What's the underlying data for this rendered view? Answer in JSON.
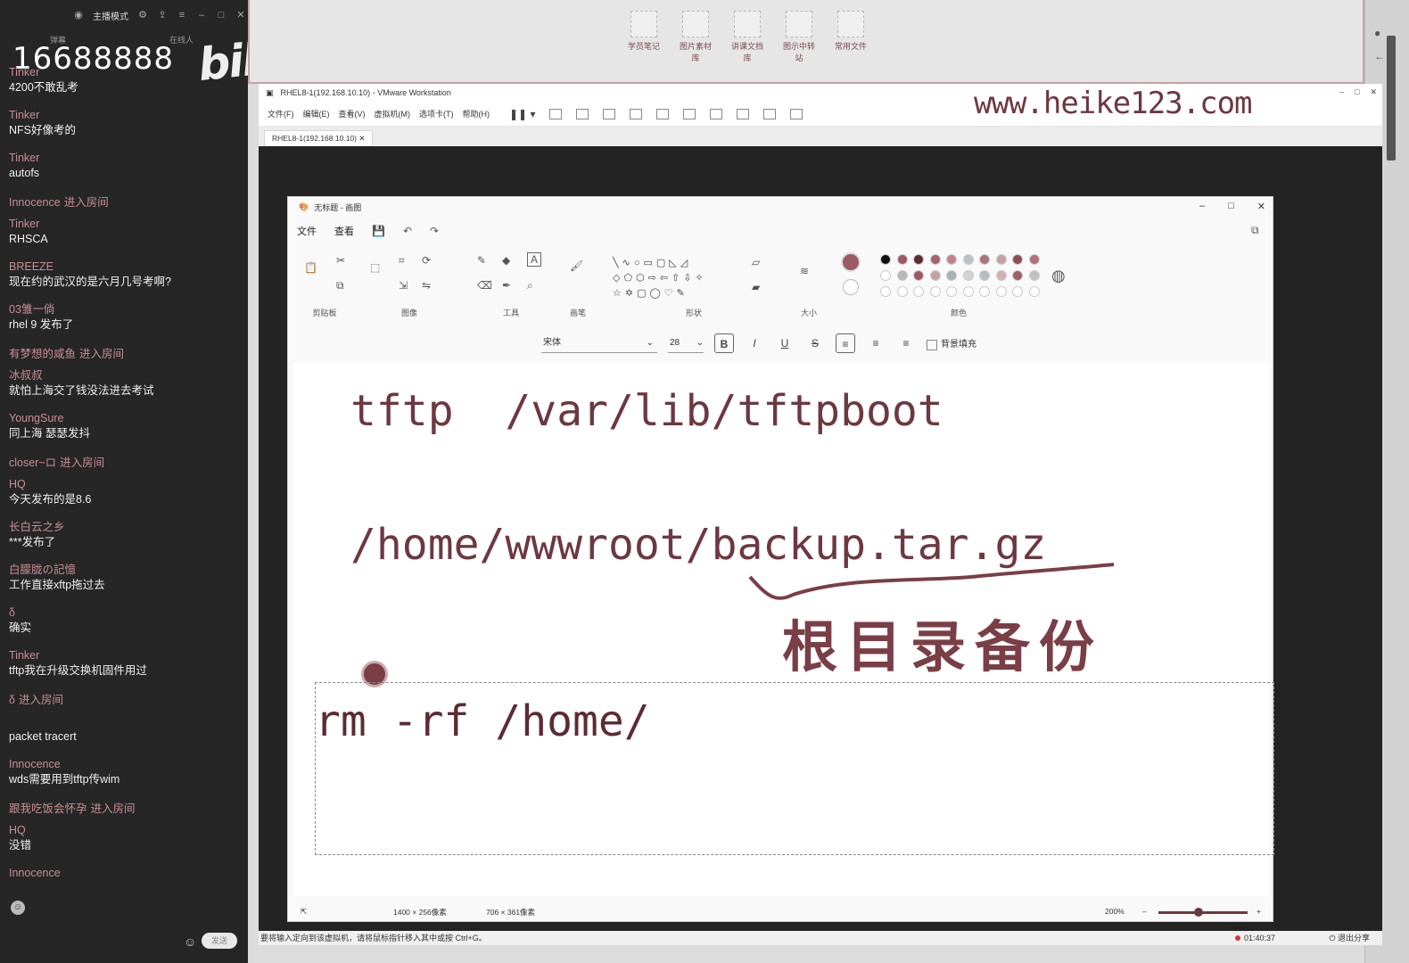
{
  "chat": {
    "topbar": {
      "mode": "主播模式"
    },
    "subtabs": {
      "left": "弹幕",
      "right": "在线人"
    },
    "watermark_number": "16688888",
    "watermark_logo": "bilibili",
    "messages": [
      {
        "user": "Tinker",
        "text": "4200不敢乱考",
        "kind": "msg"
      },
      {
        "user": "Tinker",
        "text": "NFS好像考的",
        "kind": "msg"
      },
      {
        "user": "Tinker",
        "text": "autofs",
        "kind": "msg"
      },
      {
        "user": "Innocence",
        "text": "进入房间",
        "kind": "enter"
      },
      {
        "user": "Tinker",
        "text": "RHSCA",
        "kind": "msg"
      },
      {
        "user": "BREEZE",
        "text": "现在约的武汉的是六月几号考啊?",
        "kind": "msg"
      },
      {
        "user": "03雏一倘",
        "text": "rhel 9 发布了",
        "kind": "msg"
      },
      {
        "user": "有梦想的咸鱼",
        "text": "进入房间",
        "kind": "enter"
      },
      {
        "user": "冰叔叔",
        "text": "就怕上海交了钱没法进去考试",
        "kind": "msg"
      },
      {
        "user": "YoungSure",
        "text": "同上海  瑟瑟发抖",
        "kind": "msg"
      },
      {
        "user": "closer~ロ",
        "text": "进入房间",
        "kind": "enter"
      },
      {
        "user": "HQ",
        "text": "今天发布的是8.6",
        "kind": "msg"
      },
      {
        "user": "长白云之乡",
        "text": "***发布了",
        "kind": "msg"
      },
      {
        "user": "白朦胧の記憶",
        "text": "工作直接xftp拖过去",
        "kind": "msg"
      },
      {
        "user": "δ",
        "text": "确实",
        "kind": "msg"
      },
      {
        "user": "Tinker",
        "text": "tftp我在升级交换机固件用过",
        "kind": "msg"
      },
      {
        "user": "δ",
        "text": "进入房间",
        "kind": "enter"
      },
      {
        "user": "",
        "text": "packet tracert",
        "kind": "msg"
      },
      {
        "user": "Innocence",
        "text": "wds需要用到tftp传wim",
        "kind": "msg"
      },
      {
        "user": "跟我吃饭会怀孕",
        "text": "进入房间",
        "kind": "enter"
      },
      {
        "user": "HQ",
        "text": "没错",
        "kind": "msg"
      },
      {
        "user": "Innocence",
        "text": "",
        "kind": "msg"
      }
    ],
    "send_label": "发送"
  },
  "desktop_icons": [
    "学员笔记",
    "图片素材库",
    "讲课文档库",
    "图示中转站",
    "常用文件"
  ],
  "vmware": {
    "title": "RHEL8-1(192.168.10.10) - VMware Workstation",
    "menu": [
      "文件(F)",
      "编辑(E)",
      "查看(V)",
      "虚拟机(M)",
      "选项卡(T)",
      "帮助(H)"
    ],
    "tab": "RHEL8-1(192.168.10.10)",
    "watermark_url": "www.heike123.com",
    "status_text": "要将输入定向到该虚拟机，请将鼠标指针移入其中或按 Ctrl+G。",
    "timer": "01:40:37",
    "end_share": "退出分享"
  },
  "paint": {
    "title": "无标题 - 画图",
    "menu": [
      "文件",
      "查看"
    ],
    "groups": [
      "剪贴板",
      "图像",
      "工具",
      "画笔",
      "形状",
      "大小",
      "颜色"
    ],
    "font": "宋体",
    "font_size": "28",
    "bg_fill": "背景填充",
    "lines": [
      "tftp  /var/lib/tftpboot",
      "/home/wwwroot/backup.tar.gz",
      "rm -rf /home/"
    ],
    "handwriting": "根目录备份",
    "status_canvas": "1400 × 256像素",
    "status_selection": "706 × 361像素",
    "zoom": "200%",
    "colors_row1": [
      "#111111",
      "#9b5a62",
      "#5b2b33",
      "#a6636b",
      "#c0848a",
      "#b9c0c3",
      "#a5767c",
      "#c7a0a5",
      "#8e4c55",
      "#b07078"
    ],
    "colors_row2": [
      "#ffffff",
      "#b7b7b7",
      "#9b5a62",
      "#c7a0a5",
      "#a9b0b3",
      "#cfd3d5",
      "#b6bcbf",
      "#d5aeb2",
      "#9e5f67",
      "#c0c0c0"
    ]
  }
}
